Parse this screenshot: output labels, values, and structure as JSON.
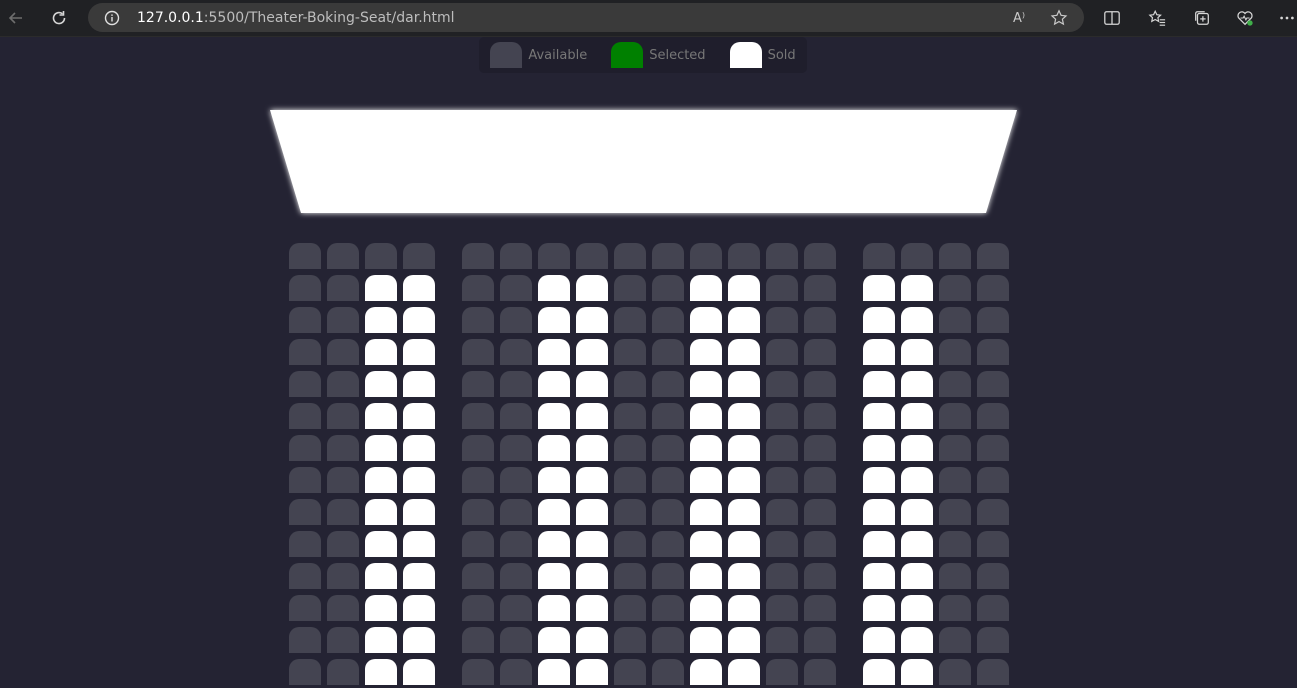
{
  "browser": {
    "url_host": "127.0.0.1",
    "url_rest": ":5500/Theater-Boking-Seat/dar.html",
    "read_aloud_icon": "A⁾"
  },
  "legend": [
    {
      "label": "Available",
      "status": "available"
    },
    {
      "label": "Selected",
      "status": "selected"
    },
    {
      "label": "Sold",
      "status": "sold"
    }
  ],
  "colors": {
    "background": "#242333",
    "available": "#444451",
    "selected": "#008000",
    "sold": "#ffffff",
    "screen": "#ffffff"
  },
  "seating": {
    "columns_per_block": [
      4,
      10,
      4
    ],
    "rows": [
      {
        "sold": []
      },
      {
        "sold": [
          2,
          3,
          6,
          7,
          10,
          11,
          14,
          15
        ]
      },
      {
        "sold": [
          2,
          3,
          6,
          7,
          10,
          11,
          14,
          15
        ]
      },
      {
        "sold": [
          2,
          3,
          6,
          7,
          10,
          11,
          14,
          15
        ]
      },
      {
        "sold": [
          2,
          3,
          6,
          7,
          10,
          11,
          14,
          15
        ]
      },
      {
        "sold": [
          2,
          3,
          6,
          7,
          10,
          11,
          14,
          15
        ]
      },
      {
        "sold": [
          2,
          3,
          6,
          7,
          10,
          11,
          14,
          15
        ]
      },
      {
        "sold": [
          2,
          3,
          6,
          7,
          10,
          11,
          14,
          15
        ]
      },
      {
        "sold": [
          2,
          3,
          6,
          7,
          10,
          11,
          14,
          15
        ]
      },
      {
        "sold": [
          2,
          3,
          6,
          7,
          10,
          11,
          14,
          15
        ]
      },
      {
        "sold": [
          2,
          3,
          6,
          7,
          10,
          11,
          14,
          15
        ]
      },
      {
        "sold": [
          2,
          3,
          6,
          7,
          10,
          11,
          14,
          15
        ]
      },
      {
        "sold": [
          2,
          3,
          6,
          7,
          10,
          11,
          14,
          15
        ]
      },
      {
        "sold": [
          2,
          3,
          6,
          7,
          10,
          11,
          14,
          15
        ]
      }
    ]
  }
}
